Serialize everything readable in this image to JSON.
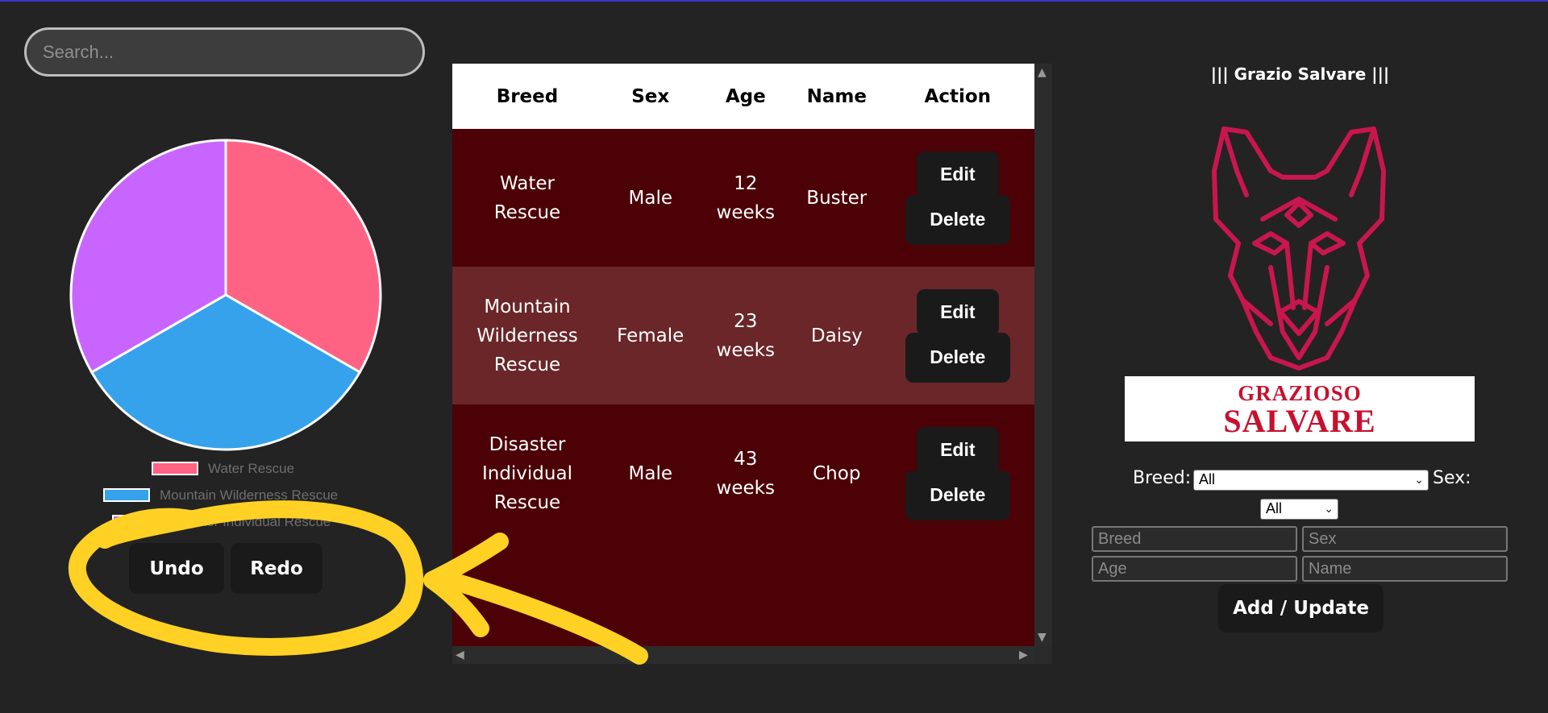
{
  "search": {
    "placeholder": "Search..."
  },
  "pie": {
    "slices": [
      {
        "label": "Water Rescue",
        "value": 1,
        "color": "#ff6384"
      },
      {
        "label": "Mountain Wilderness Rescue",
        "value": 1,
        "color": "#36a2eb"
      },
      {
        "label": "Disaster Individual Rescue",
        "value": 1,
        "color": "#c865ff"
      }
    ],
    "legend": [
      "Water Rescue",
      "Mountain Wilderness Rescue",
      "Disaster Individual Rescue"
    ]
  },
  "history": {
    "undo": "Undo",
    "redo": "Redo"
  },
  "highlight": {
    "color": "#ffd124"
  },
  "table": {
    "headers": [
      "Breed",
      "Sex",
      "Age",
      "Name",
      "Action"
    ],
    "rows": [
      {
        "breed": "Water Rescue",
        "sex": "Male",
        "age": "12 weeks",
        "name": "Buster"
      },
      {
        "breed": "Mountain Wilderness Rescue",
        "sex": "Female",
        "age": "23 weeks",
        "name": "Daisy"
      },
      {
        "breed": "Disaster Individual Rescue",
        "sex": "Male",
        "age": "43 weeks",
        "name": "Chop"
      }
    ],
    "edit_label": "Edit",
    "delete_label": "Delete"
  },
  "brand": {
    "title": "||| Grazio Salvare |||",
    "logo_top": "GRAZIOSO",
    "logo_bottom": "SALVARE",
    "accent": "#c8164e"
  },
  "filters": {
    "breed_label": "Breed:",
    "breed_value": "All",
    "sex_label": "Sex:",
    "sex_value": "All"
  },
  "form": {
    "breed_placeholder": "Breed",
    "sex_placeholder": "Sex",
    "age_placeholder": "Age",
    "name_placeholder": "Name",
    "submit_label": "Add / Update"
  }
}
